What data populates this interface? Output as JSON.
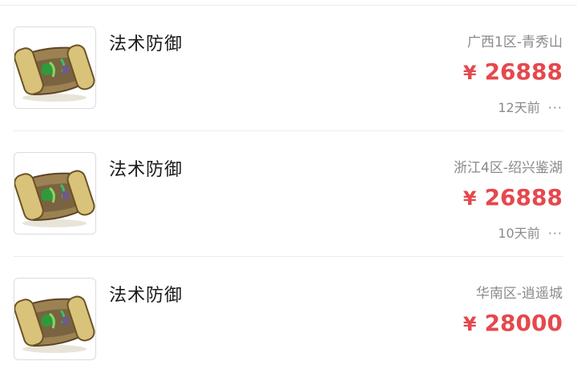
{
  "listings": [
    {
      "title": "法术防御",
      "server": "广西1区-青秀山",
      "currency": "¥",
      "price": "26888",
      "time_ago": "12天前",
      "more_icon": "···",
      "thumbnail_icon": "scroll-item-icon"
    },
    {
      "title": "法术防御",
      "server": "浙江4区-绍兴鉴湖",
      "currency": "¥",
      "price": "26888",
      "time_ago": "10天前",
      "more_icon": "···",
      "thumbnail_icon": "scroll-item-icon"
    },
    {
      "title": "法术防御",
      "server": "华南区-逍遥城",
      "currency": "¥",
      "price": "28000",
      "thumbnail_icon": "scroll-item-icon"
    }
  ],
  "colors": {
    "price": "#e5484d",
    "secondary_text": "#8a8a8a",
    "title_text": "#1a1a1a"
  }
}
